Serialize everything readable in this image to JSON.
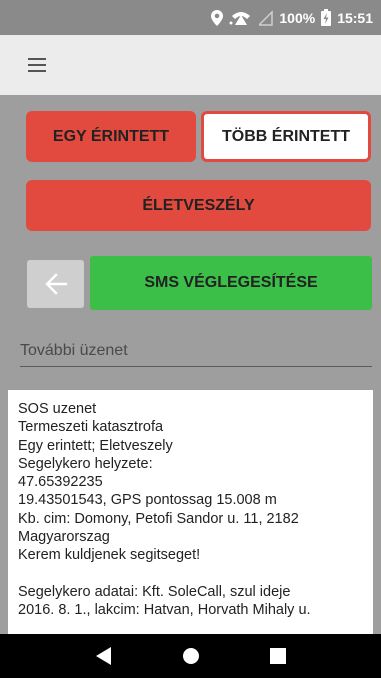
{
  "status_bar": {
    "battery_percent": "100%",
    "time": "15:51"
  },
  "app_bar": {
    "menu_icon": "hamburger-menu-icon"
  },
  "buttons": {
    "single_affected": "EGY ÉRINTETT",
    "multiple_affected": "TÖBB ÉRINTETT",
    "life_threat": "ÉLETVESZÉLY",
    "back_icon": "arrow-left-icon",
    "finalize_sms": "SMS VÉGLEGESÍTÉSE"
  },
  "additional_message": {
    "placeholder": "További üzenet"
  },
  "message_lines": [
    "SOS uzenet",
    "Termeszeti katasztrofa",
    "Egy erintett; Eletveszely",
    "Segelykero helyzete:",
    "47.65392235",
    "19.43501543, GPS pontossag 15.008 m",
    "Kb. cim: Domony, Petofi Sandor u. 11, 2182",
    "Magyarorszag",
    "Kerem kuldjenek segitseget!",
    "",
    "Segelykero adatai: Kft. SoleCall, szul ideje",
    "2016. 8. 1., lakcim: Hatvan, Horvath Mihaly u."
  ],
  "colors": {
    "red": "#e24a3f",
    "green": "#3cbf49",
    "background": "#9e9e9e"
  }
}
